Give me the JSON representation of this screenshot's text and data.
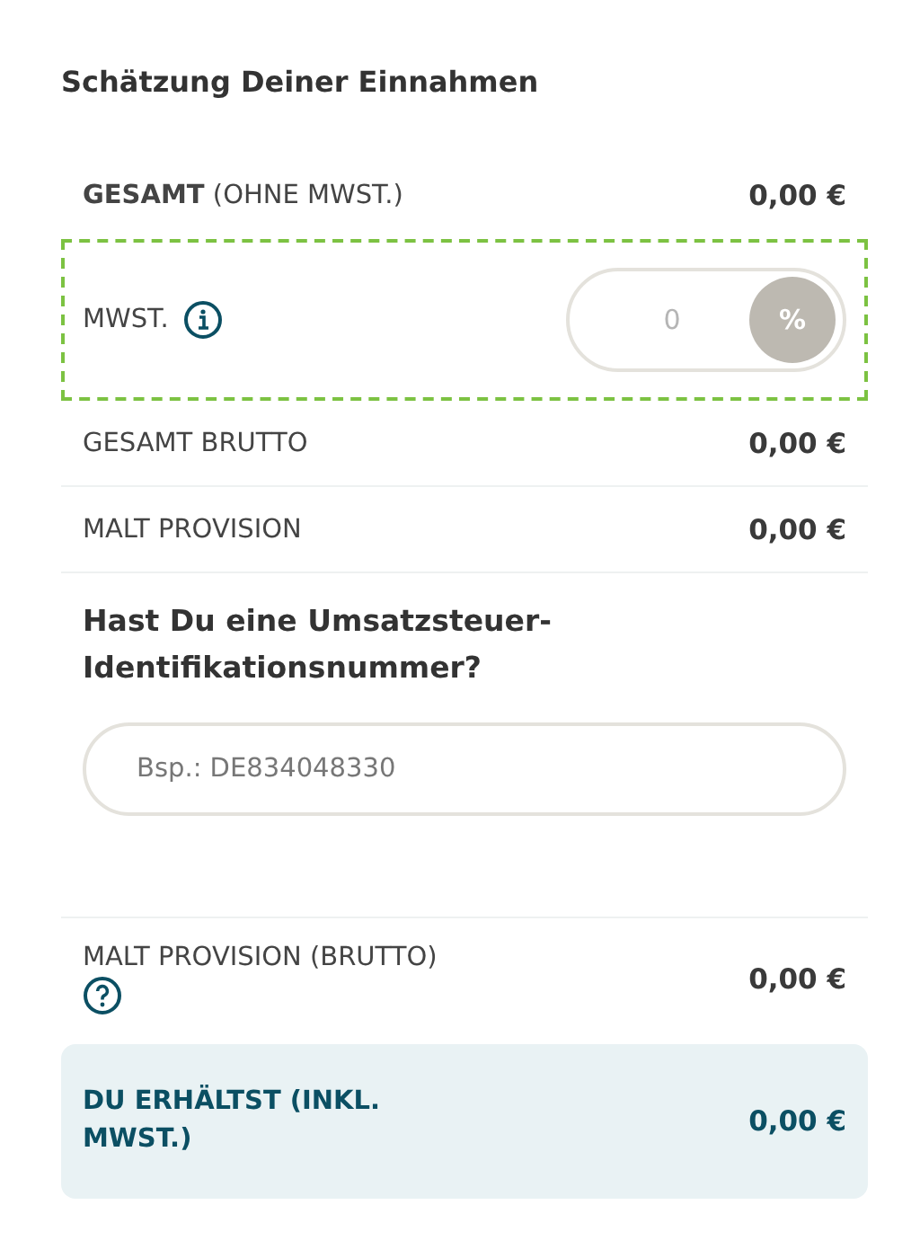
{
  "title": "Schätzung Deiner Einnahmen",
  "rows": [
    {
      "kind": "amount",
      "label": "**GESAMT** (OHNE MWST.)",
      "value": "0,00 €"
    },
    {
      "kind": "vat",
      "label": "MWST.",
      "placeholder": "0",
      "unit": "%",
      "highlighted": true
    },
    {
      "kind": "amount",
      "label": "GESAMT BRUTTO",
      "value": "0,00 €"
    },
    {
      "kind": "amount",
      "label": "MALT PROVISION",
      "value": "0,00 €"
    }
  ],
  "vat_id": {
    "question": "Hast Du eine Umsatzsteuer-Identifikationsnummer?",
    "placeholder": "Bsp.: DE834048330"
  },
  "commission": {
    "label": "MALT PROVISION (BRUTTO)",
    "value": "0,00 €"
  },
  "payout": {
    "label": "DU ERHÄLTST (INKL. MWST.)",
    "value": "0,00 €"
  }
}
